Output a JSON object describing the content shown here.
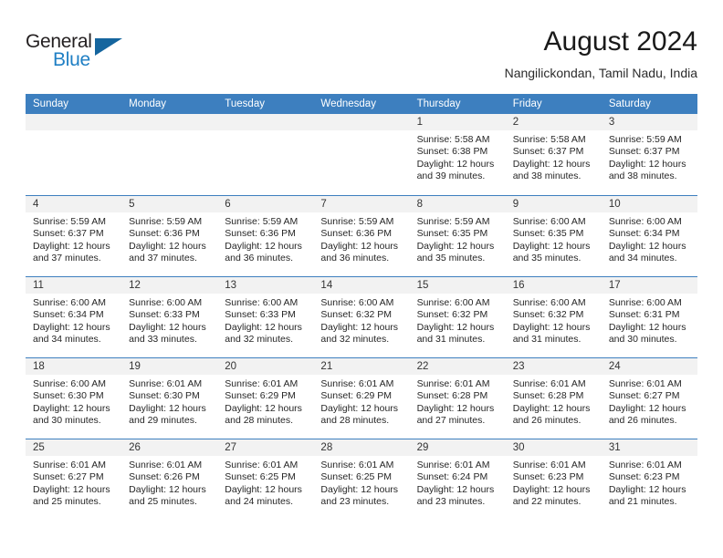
{
  "brand": {
    "name_part1": "General",
    "name_part2": "Blue",
    "flag_icon": "blue-flag-icon"
  },
  "header": {
    "month_title": "August 2024",
    "location": "Nangilickondan, Tamil Nadu, India"
  },
  "colors": {
    "header_blue": "#3d7fbf",
    "brand_blue": "#1f7fc4",
    "flag_blue": "#15659e",
    "day_band_gray": "#f2f2f2"
  },
  "calendar": {
    "weekdays": [
      "Sunday",
      "Monday",
      "Tuesday",
      "Wednesday",
      "Thursday",
      "Friday",
      "Saturday"
    ],
    "weeks": [
      [
        {
          "day": "",
          "empty": true,
          "sunrise": "",
          "sunset": "",
          "daylight_line1": "",
          "daylight_line2": ""
        },
        {
          "day": "",
          "empty": true,
          "sunrise": "",
          "sunset": "",
          "daylight_line1": "",
          "daylight_line2": ""
        },
        {
          "day": "",
          "empty": true,
          "sunrise": "",
          "sunset": "",
          "daylight_line1": "",
          "daylight_line2": ""
        },
        {
          "day": "",
          "empty": true,
          "sunrise": "",
          "sunset": "",
          "daylight_line1": "",
          "daylight_line2": ""
        },
        {
          "day": "1",
          "empty": false,
          "sunrise": "Sunrise: 5:58 AM",
          "sunset": "Sunset: 6:38 PM",
          "daylight_line1": "Daylight: 12 hours",
          "daylight_line2": "and 39 minutes."
        },
        {
          "day": "2",
          "empty": false,
          "sunrise": "Sunrise: 5:58 AM",
          "sunset": "Sunset: 6:37 PM",
          "daylight_line1": "Daylight: 12 hours",
          "daylight_line2": "and 38 minutes."
        },
        {
          "day": "3",
          "empty": false,
          "sunrise": "Sunrise: 5:59 AM",
          "sunset": "Sunset: 6:37 PM",
          "daylight_line1": "Daylight: 12 hours",
          "daylight_line2": "and 38 minutes."
        }
      ],
      [
        {
          "day": "4",
          "empty": false,
          "sunrise": "Sunrise: 5:59 AM",
          "sunset": "Sunset: 6:37 PM",
          "daylight_line1": "Daylight: 12 hours",
          "daylight_line2": "and 37 minutes."
        },
        {
          "day": "5",
          "empty": false,
          "sunrise": "Sunrise: 5:59 AM",
          "sunset": "Sunset: 6:36 PM",
          "daylight_line1": "Daylight: 12 hours",
          "daylight_line2": "and 37 minutes."
        },
        {
          "day": "6",
          "empty": false,
          "sunrise": "Sunrise: 5:59 AM",
          "sunset": "Sunset: 6:36 PM",
          "daylight_line1": "Daylight: 12 hours",
          "daylight_line2": "and 36 minutes."
        },
        {
          "day": "7",
          "empty": false,
          "sunrise": "Sunrise: 5:59 AM",
          "sunset": "Sunset: 6:36 PM",
          "daylight_line1": "Daylight: 12 hours",
          "daylight_line2": "and 36 minutes."
        },
        {
          "day": "8",
          "empty": false,
          "sunrise": "Sunrise: 5:59 AM",
          "sunset": "Sunset: 6:35 PM",
          "daylight_line1": "Daylight: 12 hours",
          "daylight_line2": "and 35 minutes."
        },
        {
          "day": "9",
          "empty": false,
          "sunrise": "Sunrise: 6:00 AM",
          "sunset": "Sunset: 6:35 PM",
          "daylight_line1": "Daylight: 12 hours",
          "daylight_line2": "and 35 minutes."
        },
        {
          "day": "10",
          "empty": false,
          "sunrise": "Sunrise: 6:00 AM",
          "sunset": "Sunset: 6:34 PM",
          "daylight_line1": "Daylight: 12 hours",
          "daylight_line2": "and 34 minutes."
        }
      ],
      [
        {
          "day": "11",
          "empty": false,
          "sunrise": "Sunrise: 6:00 AM",
          "sunset": "Sunset: 6:34 PM",
          "daylight_line1": "Daylight: 12 hours",
          "daylight_line2": "and 34 minutes."
        },
        {
          "day": "12",
          "empty": false,
          "sunrise": "Sunrise: 6:00 AM",
          "sunset": "Sunset: 6:33 PM",
          "daylight_line1": "Daylight: 12 hours",
          "daylight_line2": "and 33 minutes."
        },
        {
          "day": "13",
          "empty": false,
          "sunrise": "Sunrise: 6:00 AM",
          "sunset": "Sunset: 6:33 PM",
          "daylight_line1": "Daylight: 12 hours",
          "daylight_line2": "and 32 minutes."
        },
        {
          "day": "14",
          "empty": false,
          "sunrise": "Sunrise: 6:00 AM",
          "sunset": "Sunset: 6:32 PM",
          "daylight_line1": "Daylight: 12 hours",
          "daylight_line2": "and 32 minutes."
        },
        {
          "day": "15",
          "empty": false,
          "sunrise": "Sunrise: 6:00 AM",
          "sunset": "Sunset: 6:32 PM",
          "daylight_line1": "Daylight: 12 hours",
          "daylight_line2": "and 31 minutes."
        },
        {
          "day": "16",
          "empty": false,
          "sunrise": "Sunrise: 6:00 AM",
          "sunset": "Sunset: 6:32 PM",
          "daylight_line1": "Daylight: 12 hours",
          "daylight_line2": "and 31 minutes."
        },
        {
          "day": "17",
          "empty": false,
          "sunrise": "Sunrise: 6:00 AM",
          "sunset": "Sunset: 6:31 PM",
          "daylight_line1": "Daylight: 12 hours",
          "daylight_line2": "and 30 minutes."
        }
      ],
      [
        {
          "day": "18",
          "empty": false,
          "sunrise": "Sunrise: 6:00 AM",
          "sunset": "Sunset: 6:30 PM",
          "daylight_line1": "Daylight: 12 hours",
          "daylight_line2": "and 30 minutes."
        },
        {
          "day": "19",
          "empty": false,
          "sunrise": "Sunrise: 6:01 AM",
          "sunset": "Sunset: 6:30 PM",
          "daylight_line1": "Daylight: 12 hours",
          "daylight_line2": "and 29 minutes."
        },
        {
          "day": "20",
          "empty": false,
          "sunrise": "Sunrise: 6:01 AM",
          "sunset": "Sunset: 6:29 PM",
          "daylight_line1": "Daylight: 12 hours",
          "daylight_line2": "and 28 minutes."
        },
        {
          "day": "21",
          "empty": false,
          "sunrise": "Sunrise: 6:01 AM",
          "sunset": "Sunset: 6:29 PM",
          "daylight_line1": "Daylight: 12 hours",
          "daylight_line2": "and 28 minutes."
        },
        {
          "day": "22",
          "empty": false,
          "sunrise": "Sunrise: 6:01 AM",
          "sunset": "Sunset: 6:28 PM",
          "daylight_line1": "Daylight: 12 hours",
          "daylight_line2": "and 27 minutes."
        },
        {
          "day": "23",
          "empty": false,
          "sunrise": "Sunrise: 6:01 AM",
          "sunset": "Sunset: 6:28 PM",
          "daylight_line1": "Daylight: 12 hours",
          "daylight_line2": "and 26 minutes."
        },
        {
          "day": "24",
          "empty": false,
          "sunrise": "Sunrise: 6:01 AM",
          "sunset": "Sunset: 6:27 PM",
          "daylight_line1": "Daylight: 12 hours",
          "daylight_line2": "and 26 minutes."
        }
      ],
      [
        {
          "day": "25",
          "empty": false,
          "sunrise": "Sunrise: 6:01 AM",
          "sunset": "Sunset: 6:27 PM",
          "daylight_line1": "Daylight: 12 hours",
          "daylight_line2": "and 25 minutes."
        },
        {
          "day": "26",
          "empty": false,
          "sunrise": "Sunrise: 6:01 AM",
          "sunset": "Sunset: 6:26 PM",
          "daylight_line1": "Daylight: 12 hours",
          "daylight_line2": "and 25 minutes."
        },
        {
          "day": "27",
          "empty": false,
          "sunrise": "Sunrise: 6:01 AM",
          "sunset": "Sunset: 6:25 PM",
          "daylight_line1": "Daylight: 12 hours",
          "daylight_line2": "and 24 minutes."
        },
        {
          "day": "28",
          "empty": false,
          "sunrise": "Sunrise: 6:01 AM",
          "sunset": "Sunset: 6:25 PM",
          "daylight_line1": "Daylight: 12 hours",
          "daylight_line2": "and 23 minutes."
        },
        {
          "day": "29",
          "empty": false,
          "sunrise": "Sunrise: 6:01 AM",
          "sunset": "Sunset: 6:24 PM",
          "daylight_line1": "Daylight: 12 hours",
          "daylight_line2": "and 23 minutes."
        },
        {
          "day": "30",
          "empty": false,
          "sunrise": "Sunrise: 6:01 AM",
          "sunset": "Sunset: 6:23 PM",
          "daylight_line1": "Daylight: 12 hours",
          "daylight_line2": "and 22 minutes."
        },
        {
          "day": "31",
          "empty": false,
          "sunrise": "Sunrise: 6:01 AM",
          "sunset": "Sunset: 6:23 PM",
          "daylight_line1": "Daylight: 12 hours",
          "daylight_line2": "and 21 minutes."
        }
      ]
    ]
  }
}
